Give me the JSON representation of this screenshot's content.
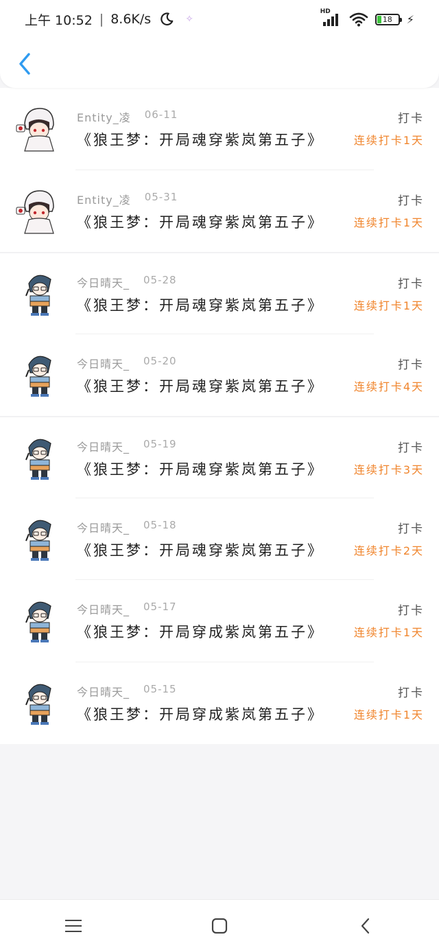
{
  "status_bar": {
    "time": "上午 10:52",
    "net_speed": "8.6K/s",
    "hd_label": "HD",
    "battery": "18"
  },
  "colors": {
    "accent": "#2f9bf0",
    "streak": "#f0852d"
  },
  "checkins": [
    {
      "user": "Entity_凌",
      "date": "06-11",
      "title": "《狼王梦：开局魂穿紫岚第五子》",
      "type": "打卡",
      "streak": "连续打卡1天",
      "avatar": "girl-white-hood"
    },
    {
      "user": "Entity_凌",
      "date": "05-31",
      "title": "《狼王梦：开局魂穿紫岚第五子》",
      "type": "打卡",
      "streak": "连续打卡1天",
      "avatar": "girl-white-hood"
    },
    {
      "user": "今日晴天_",
      "date": "05-28",
      "title": "《狼王梦：开局魂穿紫岚第五子》",
      "type": "打卡",
      "streak": "连续打卡1天",
      "avatar": "boy-shark-hood"
    },
    {
      "user": "今日晴天_",
      "date": "05-20",
      "title": "《狼王梦：开局魂穿紫岚第五子》",
      "type": "打卡",
      "streak": "连续打卡4天",
      "avatar": "boy-shark-hood"
    },
    {
      "user": "今日晴天_",
      "date": "05-19",
      "title": "《狼王梦：开局魂穿紫岚第五子》",
      "type": "打卡",
      "streak": "连续打卡3天",
      "avatar": "boy-shark-hood"
    },
    {
      "user": "今日晴天_",
      "date": "05-18",
      "title": "《狼王梦：开局魂穿紫岚第五子》",
      "type": "打卡",
      "streak": "连续打卡2天",
      "avatar": "boy-shark-hood"
    },
    {
      "user": "今日晴天_",
      "date": "05-17",
      "title": "《狼王梦：开局穿成紫岚第五子》",
      "type": "打卡",
      "streak": "连续打卡1天",
      "avatar": "boy-shark-hood"
    },
    {
      "user": "今日晴天_",
      "date": "05-15",
      "title": "《狼王梦：开局穿成紫岚第五子》",
      "type": "打卡",
      "streak": "连续打卡1天",
      "avatar": "boy-shark-hood"
    }
  ]
}
